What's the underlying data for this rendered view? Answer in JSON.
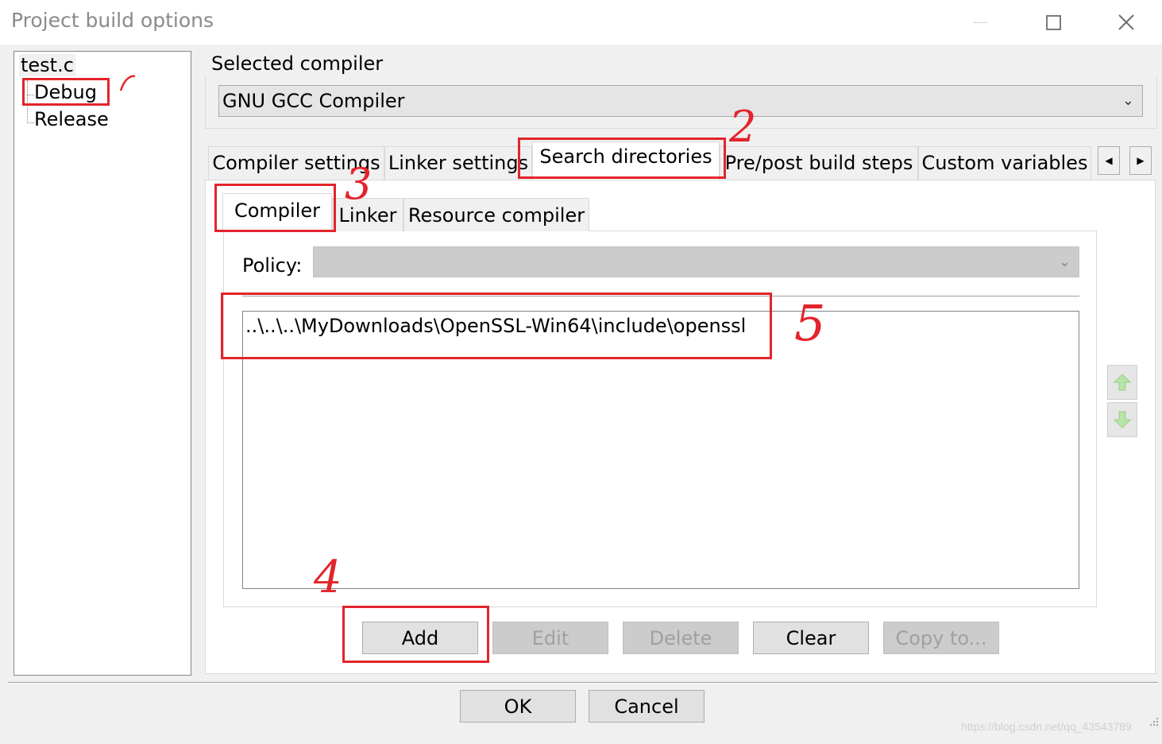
{
  "window": {
    "title": "Project build options"
  },
  "tree": {
    "root": "test.c",
    "items": [
      "Debug",
      "Release"
    ]
  },
  "compiler": {
    "label": "Selected compiler",
    "value": "GNU GCC Compiler"
  },
  "tabs": [
    "Compiler settings",
    "Linker settings",
    "Search directories",
    "Pre/post build steps",
    "Custom variables"
  ],
  "active_tab": "Search directories",
  "subtabs": [
    "Compiler",
    "Linker",
    "Resource compiler"
  ],
  "active_subtab": "Compiler",
  "policy": {
    "label": "Policy:",
    "value": ""
  },
  "directories": [
    "..\\..\\..\\MyDownloads\\OpenSSL-Win64\\include\\openssl"
  ],
  "buttons": {
    "add": "Add",
    "edit": "Edit",
    "delete": "Delete",
    "clear": "Clear",
    "copy_to": "Copy to...",
    "ok": "OK",
    "cancel": "Cancel"
  },
  "annotations": [
    "1",
    "2",
    "3",
    "4",
    "5"
  ],
  "annotation_color": "#e3242b",
  "watermark": "https://blog.csdn.net/qq_43543789",
  "icons": [
    "minimize-icon",
    "maximize-icon",
    "close-icon",
    "chevron-down-icon",
    "scroll-left-icon",
    "scroll-right-icon",
    "move-up-icon",
    "move-down-icon"
  ]
}
